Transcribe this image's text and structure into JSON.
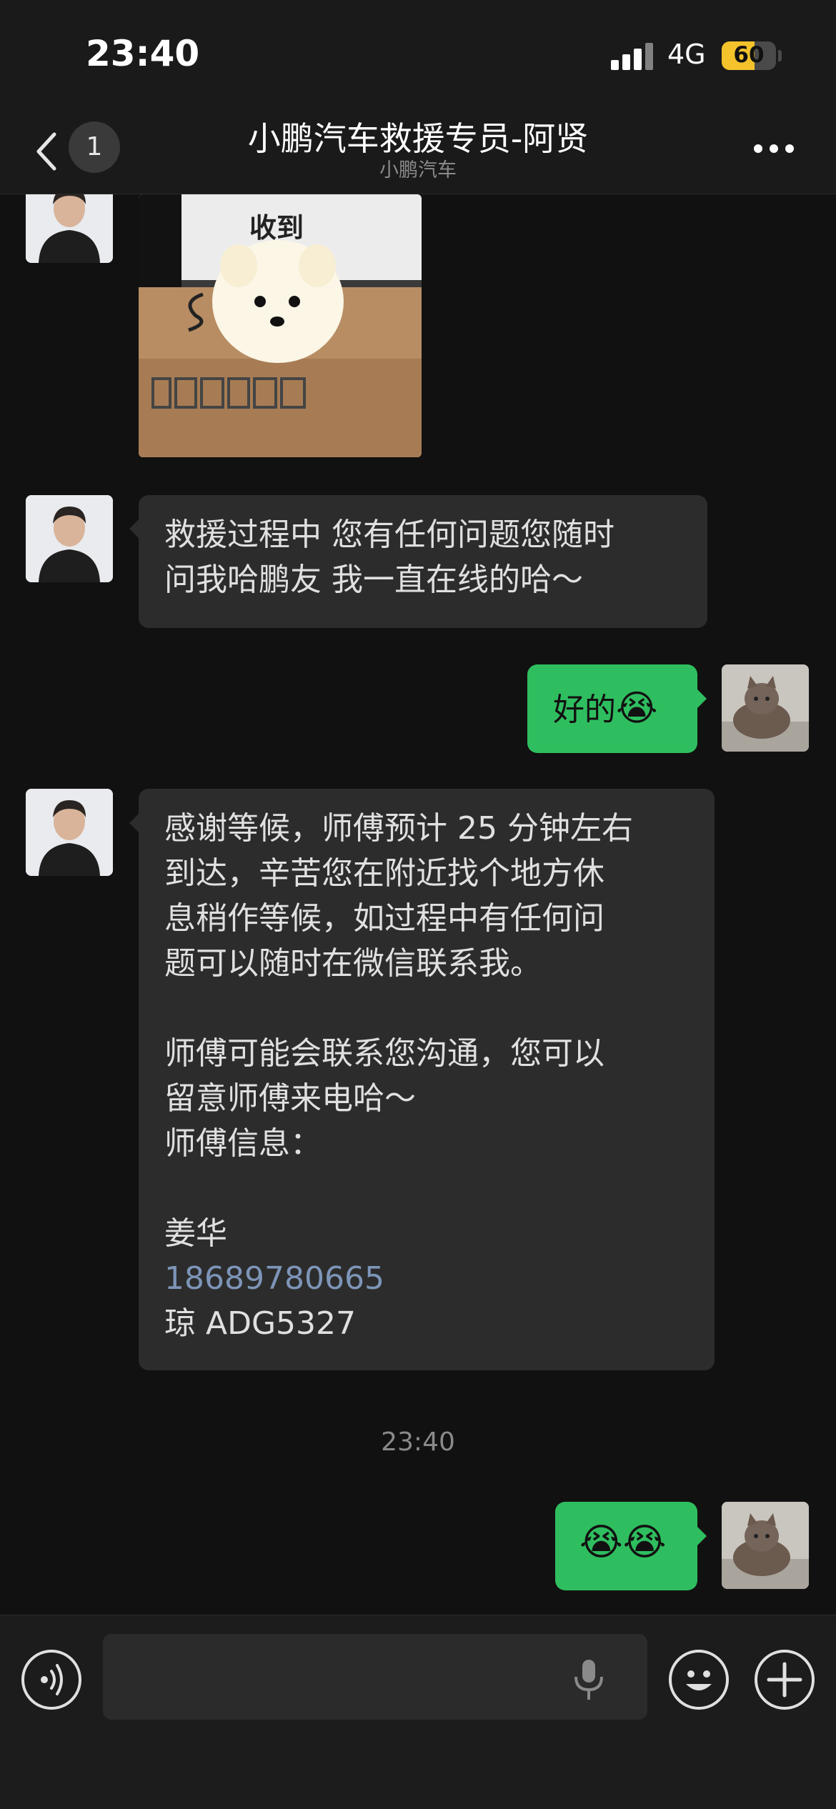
{
  "status_bar": {
    "time": "23:40",
    "network": "4G",
    "battery": "60",
    "battery_level_percent": 60
  },
  "nav": {
    "back_count": "1",
    "title": "小鹏汽车救援专员-阿贤",
    "subtitle": "小鹏汽车"
  },
  "messages": [
    {
      "from": "agent",
      "kind": "sticker",
      "caption": "收到"
    },
    {
      "from": "agent",
      "kind": "text",
      "lines": [
        "救援过程中 您有任何问题您随时",
        "问我哈鹏友 我一直在线的哈～"
      ]
    },
    {
      "from": "me",
      "kind": "text",
      "text": "好的",
      "emoji": "😭"
    },
    {
      "from": "agent",
      "kind": "text",
      "lines": [
        "感谢等候，师傅预计 25 分钟左右",
        "到达，辛苦您在附近找个地方休",
        "息稍作等候，如过程中有任何问",
        "题可以随时在微信联系我。",
        "",
        "师傅可能会联系您沟通，您可以",
        "留意师傅来电哈～",
        "师傅信息：",
        "",
        "姜华"
      ],
      "phone": "18689780665",
      "plate": "琼 ADG5327"
    },
    {
      "from": "me",
      "kind": "emoji",
      "text": "😭😭"
    }
  ],
  "timestamp": "23:40",
  "colors": {
    "background": "#111111",
    "bubble_in": "#2c2c2c",
    "bubble_out": "#2fbe5f",
    "link": "#7d95b8"
  },
  "icons": [
    "back-icon",
    "more-icon",
    "voice-icon",
    "mic-icon",
    "emoji-icon",
    "plus-icon"
  ]
}
